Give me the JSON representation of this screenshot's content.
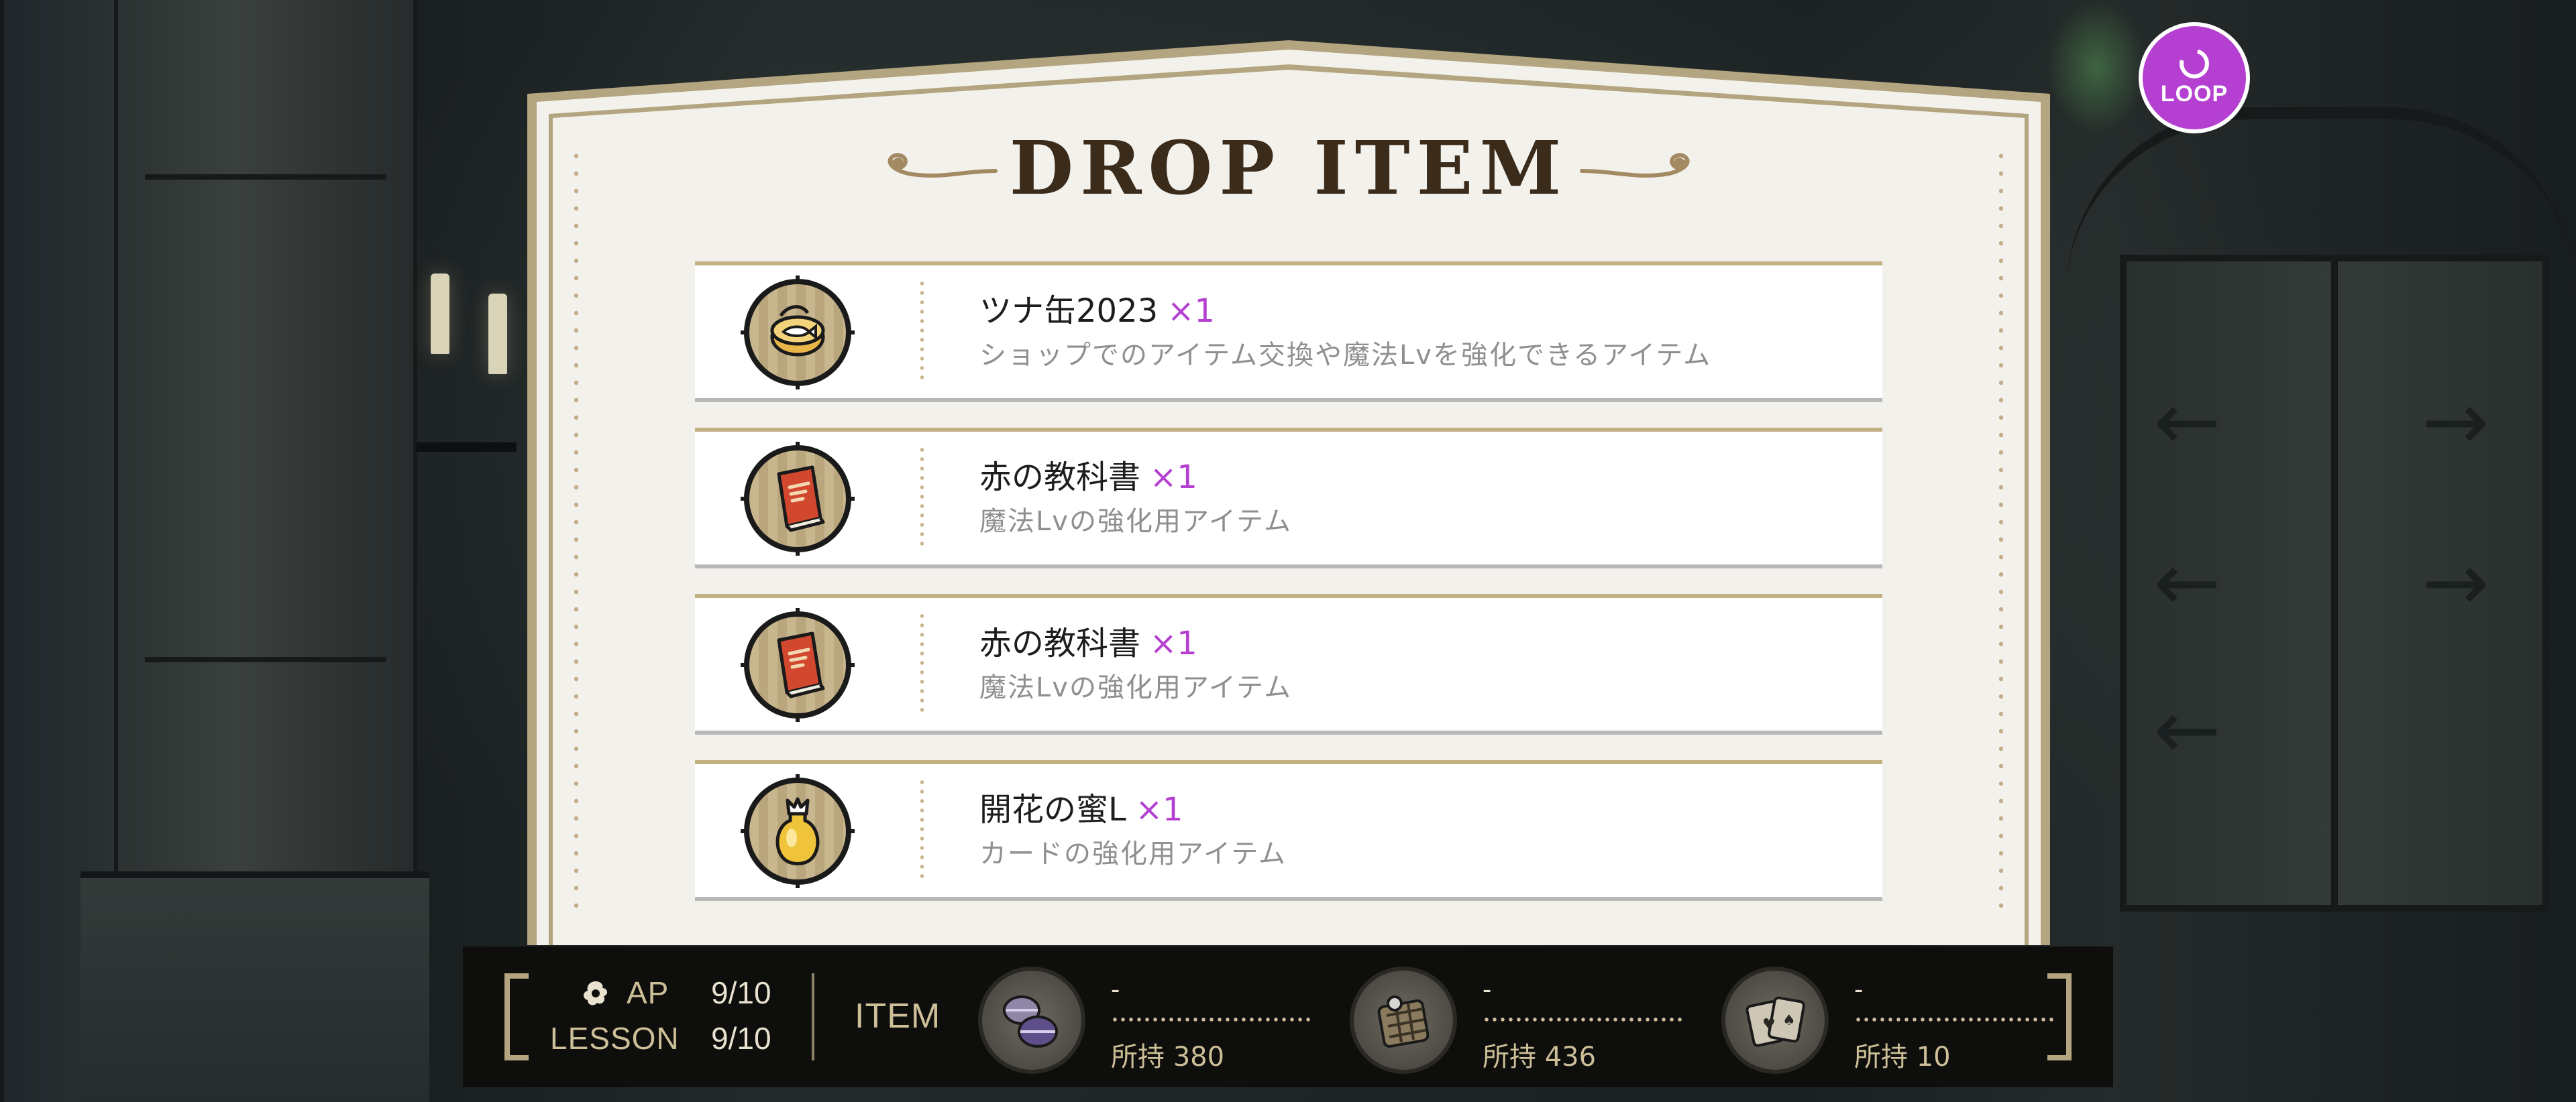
{
  "loop_button": {
    "label": "LOOP"
  },
  "panel": {
    "title": "DROP ITEM",
    "items": [
      {
        "name": "ツナ缶2023",
        "qty": "×1",
        "desc": "ショップでのアイテム交換や魔法Lvを強化できるアイテム",
        "icon": "tuna-can-icon"
      },
      {
        "name": "赤の教科書",
        "qty": "×1",
        "desc": "魔法Lvの強化用アイテム",
        "icon": "red-textbook-icon"
      },
      {
        "name": "赤の教科書",
        "qty": "×1",
        "desc": "魔法Lvの強化用アイテム",
        "icon": "red-textbook-icon"
      },
      {
        "name": "開花の蜜L",
        "qty": "×1",
        "desc": "カードの強化用アイテム",
        "icon": "honey-jar-icon"
      }
    ]
  },
  "hud": {
    "ap_label": "AP",
    "ap_value": "9/10",
    "lesson_label": "LESSON",
    "lesson_value": "9/10",
    "item_label": "ITEM",
    "resources": [
      {
        "icon": "macaron-icon",
        "gain": "-",
        "owned": "所持 380"
      },
      {
        "icon": "waffle-icon",
        "gain": "-",
        "owned": "所持 436"
      },
      {
        "icon": "playing-cards-icon",
        "gain": "-",
        "owned": "所持 10"
      }
    ]
  },
  "colors": {
    "accent_purple": "#b43fd1",
    "panel_gold": "#b3a580",
    "panel_bg": "#f3f1ec",
    "hud_bg": "#0e0e0d"
  }
}
